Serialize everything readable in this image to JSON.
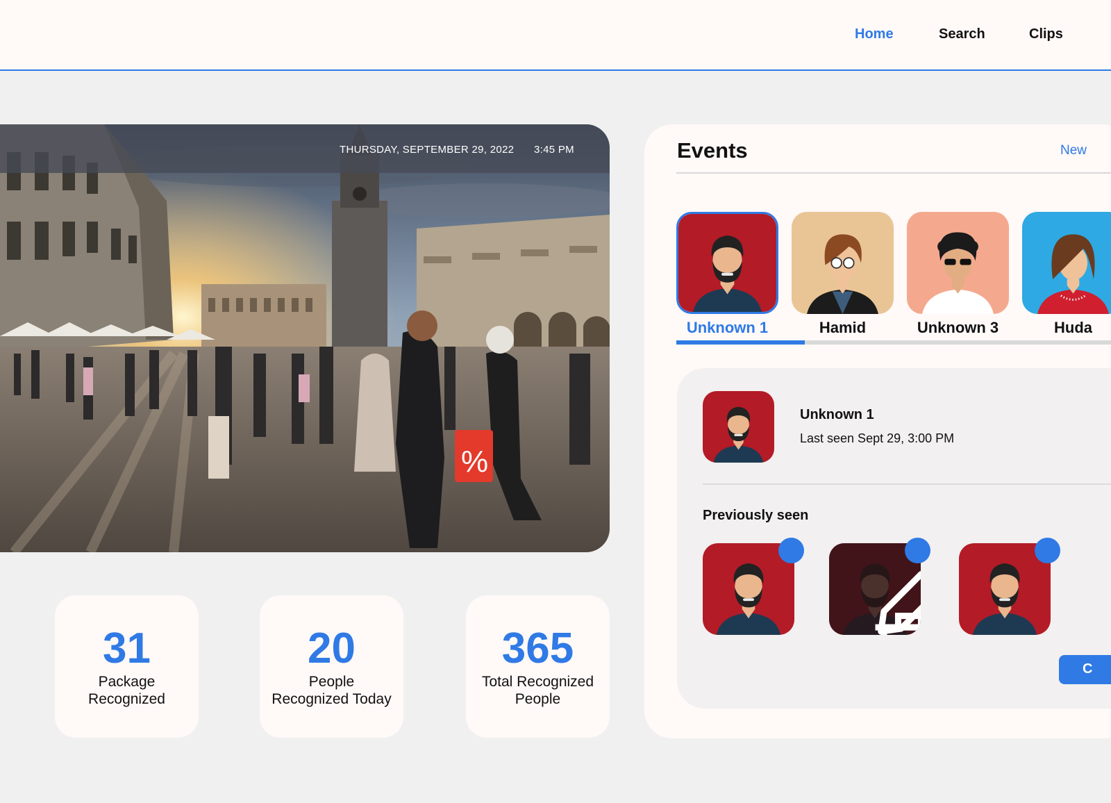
{
  "nav": {
    "items": [
      {
        "label": "Home",
        "active": true
      },
      {
        "label": "Search",
        "active": false
      },
      {
        "label": "Clips",
        "active": false
      }
    ],
    "accent_color": "#2f7ae5"
  },
  "feed": {
    "date": "THURSDAY, SEPTEMBER 29, 2022",
    "time": "3:45 PM"
  },
  "stats": [
    {
      "value": "31",
      "label_line1": "Package",
      "label_line2": "Recognized"
    },
    {
      "value": "20",
      "label_line1": "People",
      "label_line2": "Recognized Today"
    },
    {
      "value": "365",
      "label_line1": "Total Recognized",
      "label_line2": "People"
    }
  ],
  "events": {
    "title": "Events",
    "new_link": "New",
    "people": [
      {
        "name": "Unknown 1",
        "selected": true,
        "bg": "#b31b27"
      },
      {
        "name": "Hamid",
        "selected": false,
        "bg": "#e9c596"
      },
      {
        "name": "Unknown 3",
        "selected": false,
        "bg": "#f4a98f"
      },
      {
        "name": "Huda",
        "selected": false,
        "bg": "#2ea9e3"
      }
    ],
    "scroll_fraction": 0.28
  },
  "detail": {
    "name": "Unknown 1",
    "last_seen": "Last seen Sept 29, 3:00 PM",
    "previously_seen_title": "Previously seen",
    "thumbnails": 3,
    "confirm_label": "C"
  },
  "icons": [
    "edit-icon",
    "trash-icon",
    "selection-dot"
  ]
}
